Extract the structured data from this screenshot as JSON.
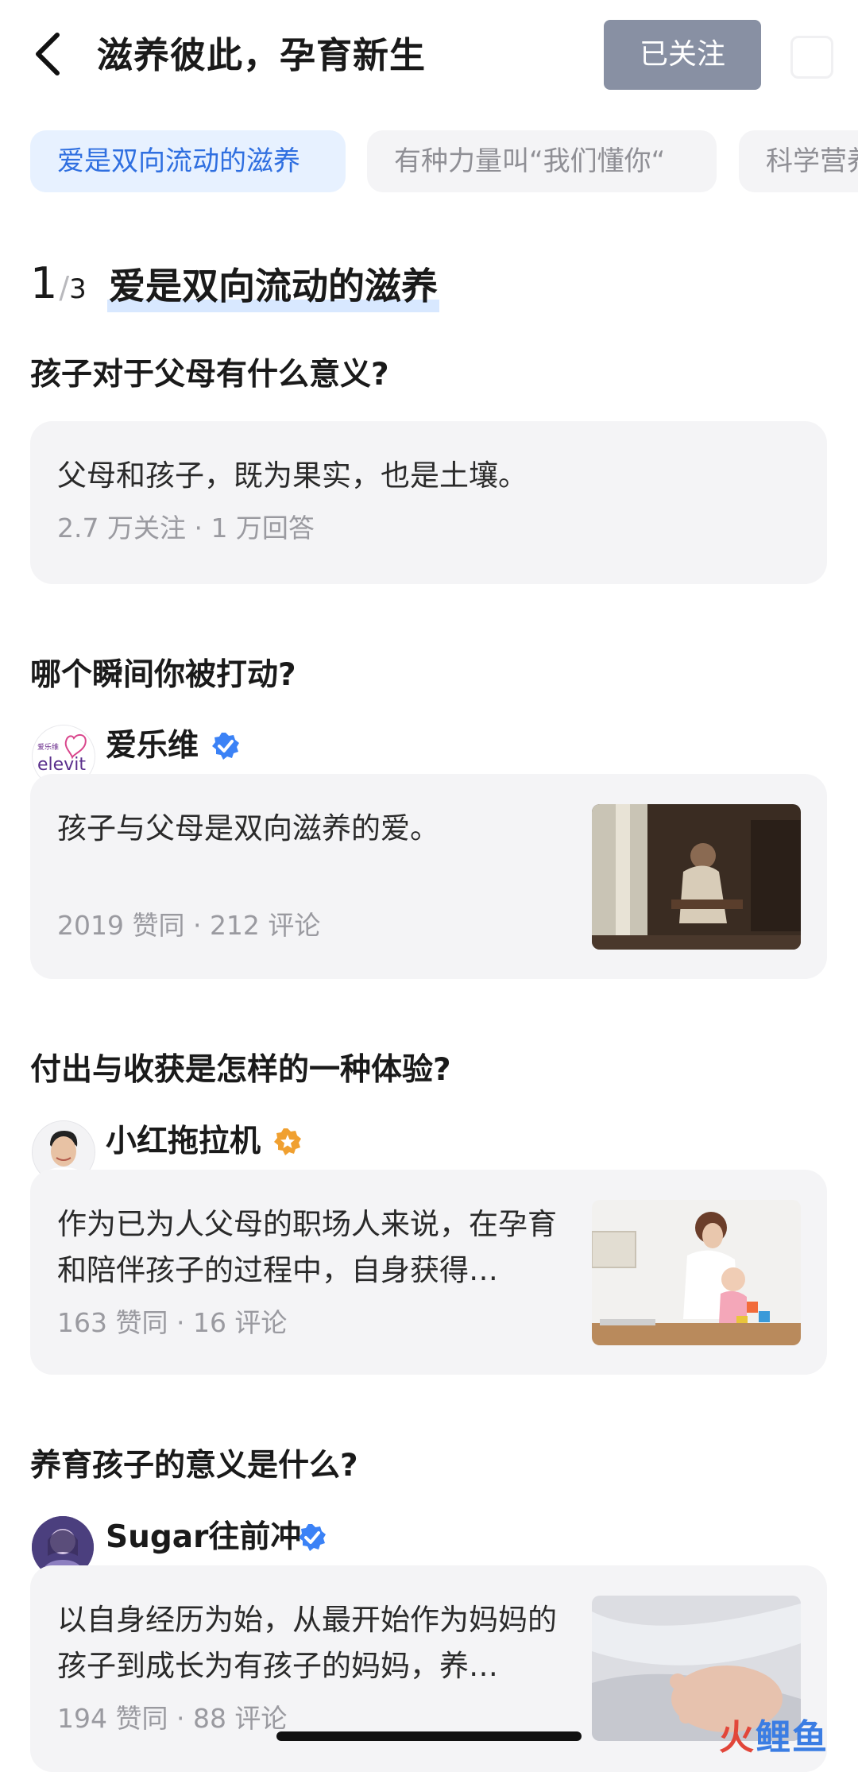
{
  "header": {
    "title": "滋养彼此，孕育新生",
    "follow_label": "已关注"
  },
  "tabs": [
    "爱是双向流动的滋养",
    "有种力量叫“我们懂你“",
    "科学营养"
  ],
  "section": {
    "index": "1",
    "total": "3",
    "title": "爱是双向流动的滋养"
  },
  "questions": [
    {
      "title": "孩子对于父母有什么意义?",
      "card_text": "父母和孩子，既为果实，也是土壤。",
      "meta": "2.7 万关注 · 1 万回答"
    },
    {
      "title": "哪个瞬间你被打动?",
      "author": "爱乐维",
      "avatar_text": "elevit",
      "avatar_small": "爱乐维",
      "badge": "verified-blue",
      "card_text": "孩子与父母是双向滋养的爱。",
      "meta": "2019 赞同 · 212 评论"
    },
    {
      "title": "付出与收获是怎样的一种体验?",
      "author": "小红拖拉机",
      "badge": "star-orange",
      "card_text": "作为已为人父母的职场人来说，在孕育和陪伴孩子的过程中，自身获得…",
      "meta": "163 赞同 · 16 评论"
    },
    {
      "title": "养育孩子的意义是什么?",
      "author": "Sugar往前冲",
      "badge": "verified-blue",
      "card_text": "以自身经历为始，从最开始作为妈妈的孩子到成长为有孩子的妈妈，养…",
      "meta": "194 赞同 · 88 评论"
    }
  ],
  "watermark": {
    "left": "火",
    "right": "鲤鱼"
  },
  "colors": {
    "accent": "#2f6fe0",
    "follow_bg": "#8890a3",
    "card_bg": "#f4f4f6",
    "meta": "#9a9aa0"
  }
}
